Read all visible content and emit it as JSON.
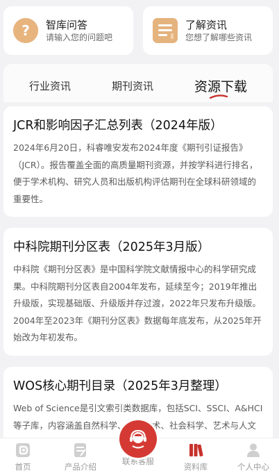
{
  "quick_cards": [
    {
      "title": "智库问答",
      "subtitle": "请输入您的问题吧",
      "icon": "question-icon"
    },
    {
      "title": "了解资讯",
      "subtitle": "您想了解哪些资讯",
      "icon": "document-icon"
    }
  ],
  "tabs": [
    {
      "label": "行业资讯",
      "active": false
    },
    {
      "label": "期刊资讯",
      "active": false
    },
    {
      "label": "资源下载",
      "active": true
    }
  ],
  "articles": [
    {
      "title": "JCR和影响因子汇总列表（2024年版）",
      "desc": "2024年6月20日，科睿唯安发布2024年度《期刊引证报告》（JCR）。报告覆盖全面的高质量期刊资源，并按学科进行排名，便于学术机构、研究人员和出版机构评估期刊在全球科研领域的重要性。"
    },
    {
      "title": "中科院期刊分区表（2025年3月版）",
      "desc": "中科院《期刊分区表》是中国科学院文献情报中心的科学研究成果。中科院期刊分区表自2004年发布，延续至今；2019年推出升级版，实现基础版、升级版并存过渡，2022年只发布升级版。2004年至2023年《期刊分区表》数据每年底发布，从2025年开始改为年初发布。"
    },
    {
      "title": "WOS核心期刊目录（2025年3月整理）",
      "desc": "Web of Science是引文索引类数据库，包括SCI、SSCI、A&HCI等子库，内容涵盖自然科学、工程技术、社会科学、艺术与人文等领域。"
    }
  ],
  "nav": [
    {
      "label": "首页",
      "icon": "home-icon",
      "active": false
    },
    {
      "label": "产品介绍",
      "icon": "product-icon",
      "active": false
    },
    {
      "label": "联系客服",
      "icon": "customer-service-icon",
      "active": false
    },
    {
      "label": "资料库",
      "icon": "library-icon",
      "active": true
    },
    {
      "label": "个人中心",
      "icon": "user-icon",
      "active": false
    }
  ],
  "colors": {
    "accent": "#d43a33",
    "icon_gold": "#e8b47e",
    "background": "#f2f2f4"
  }
}
